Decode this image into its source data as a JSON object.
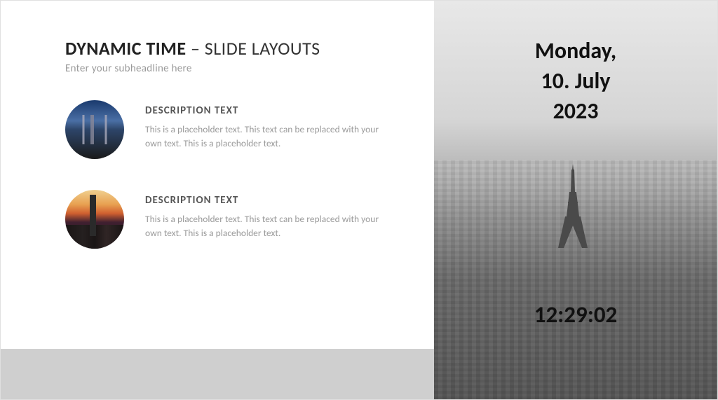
{
  "header": {
    "title_bold": "DYNAMIC TIME",
    "title_rest": " – SLIDE LAYOUTS",
    "subheadline": "Enter your subheadline here"
  },
  "items": [
    {
      "icon_name": "bridge-photo",
      "title": "DESCRIPTION TEXT",
      "body": "This is a placeholder text. This text can be replaced with your own text. This is a placeholder text."
    },
    {
      "icon_name": "skyline-photo",
      "title": "DESCRIPTION TEXT",
      "body": "This is a placeholder text. This text can be replaced with your own text. This is a placeholder text."
    }
  ],
  "overlay": {
    "date_line1": "Monday,",
    "date_line2": "10. July",
    "date_line3": "2023",
    "time": "12:29:02"
  }
}
